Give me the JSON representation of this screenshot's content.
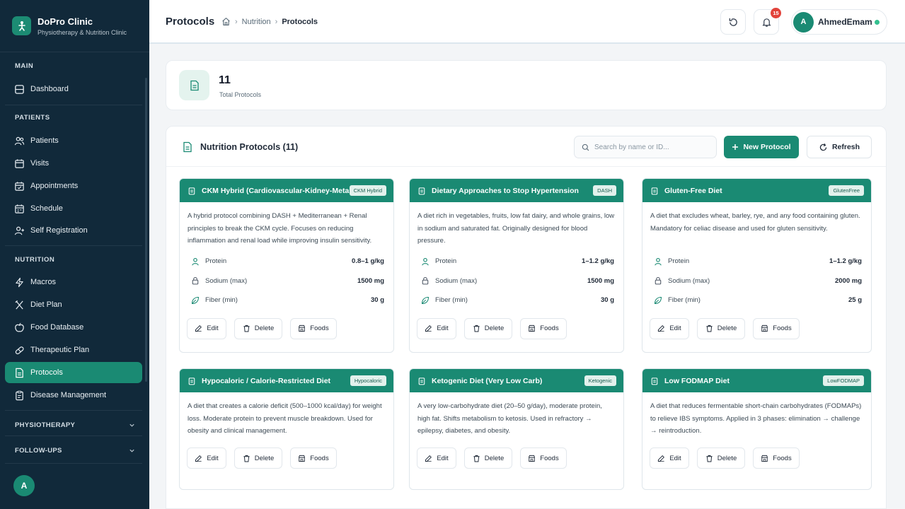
{
  "brand": {
    "name": "DoPro Clinic",
    "subtitle": "Physiotherapy & Nutrition Clinic"
  },
  "sidebar": {
    "sections": {
      "main": "MAIN",
      "patients": "PATIENTS",
      "nutrition": "NUTRITION"
    },
    "items": {
      "dashboard": "Dashboard",
      "patients": "Patients",
      "visits": "Visits",
      "appointments": "Appointments",
      "schedule": "Schedule",
      "self_registration": "Self Registration",
      "macros": "Macros",
      "diet_plan": "Diet Plan",
      "food_database": "Food Database",
      "therapeutic_plan": "Therapeutic Plan",
      "protocols": "Protocols",
      "disease_management": "Disease Management"
    },
    "collapsibles": {
      "physiotherapy": "PHYSIOTHERAPY",
      "follow_ups": "FOLLOW-UPS"
    },
    "avatar_initial": "A",
    "active_item": "Protocols"
  },
  "header": {
    "title": "Protocols",
    "breadcrumb": {
      "parent": "Nutrition",
      "current": "Protocols"
    },
    "notification_count": "15",
    "user": {
      "initial": "A",
      "name": "AhmedEmam",
      "status": "online"
    }
  },
  "stats": {
    "total_value": "11",
    "total_label": "Total Protocols"
  },
  "panel": {
    "title": "Nutrition Protocols (11)",
    "search_placeholder": "Search by name or ID...",
    "new_label": "New Protocol",
    "refresh_label": "Refresh"
  },
  "action_labels": {
    "edit": "Edit",
    "delete": "Delete",
    "foods": "Foods"
  },
  "macro_labels": {
    "protein": "Protein",
    "sodium": "Sodium (max)",
    "fiber": "Fiber (min)"
  },
  "protocols": [
    {
      "title": "CKM Hybrid (Cardiovascular-Kidney-Metabolic)",
      "tag": "CKM Hybrid",
      "description": "A hybrid protocol combining DASH + Mediterranean + Renal principles to break the CKM cycle. Focuses on reducing inflammation and renal load while improving insulin sensitivity.",
      "protein": "0.8–1 g/kg",
      "sodium": "1500 mg",
      "fiber": "30 g"
    },
    {
      "title": "Dietary Approaches to Stop Hypertension",
      "tag": "DASH",
      "description": "A diet rich in vegetables, fruits, low fat dairy, and whole grains, low in sodium and saturated fat. Originally designed for blood pressure.",
      "protein": "1–1.2 g/kg",
      "sodium": "1500 mg",
      "fiber": "30 g"
    },
    {
      "title": "Gluten-Free Diet",
      "tag": "GlutenFree",
      "description": "A diet that excludes wheat, barley, rye, and any food containing gluten. Mandatory for celiac disease and used for gluten sensitivity.",
      "protein": "1–1.2 g/kg",
      "sodium": "2000 mg",
      "fiber": "25 g"
    },
    {
      "title": "Hypocaloric / Calorie-Restricted Diet",
      "tag": "Hypocaloric",
      "description": "A diet that creates a calorie deficit (500–1000 kcal/day) for weight loss. Moderate protein to prevent muscle breakdown. Used for obesity and clinical management."
    },
    {
      "title": "Ketogenic Diet (Very Low Carb)",
      "tag": "Ketogenic",
      "description": "A very low-carbohydrate diet (20–50 g/day), moderate protein, high fat. Shifts metabolism to ketosis. Used in refractory → epilepsy, diabetes, and obesity."
    },
    {
      "title": "Low FODMAP Diet",
      "tag": "LowFODMAP",
      "description": "A diet that reduces fermentable short-chain carbohydrates (FODMAPs) to relieve IBS symptoms. Applied in 3 phases: elimination → challenge → reintroduction."
    }
  ],
  "colors": {
    "sidebar_bg": "#11293a",
    "accent": "#1a8a73",
    "badge_red": "#e2423a",
    "online": "#34c08f"
  }
}
